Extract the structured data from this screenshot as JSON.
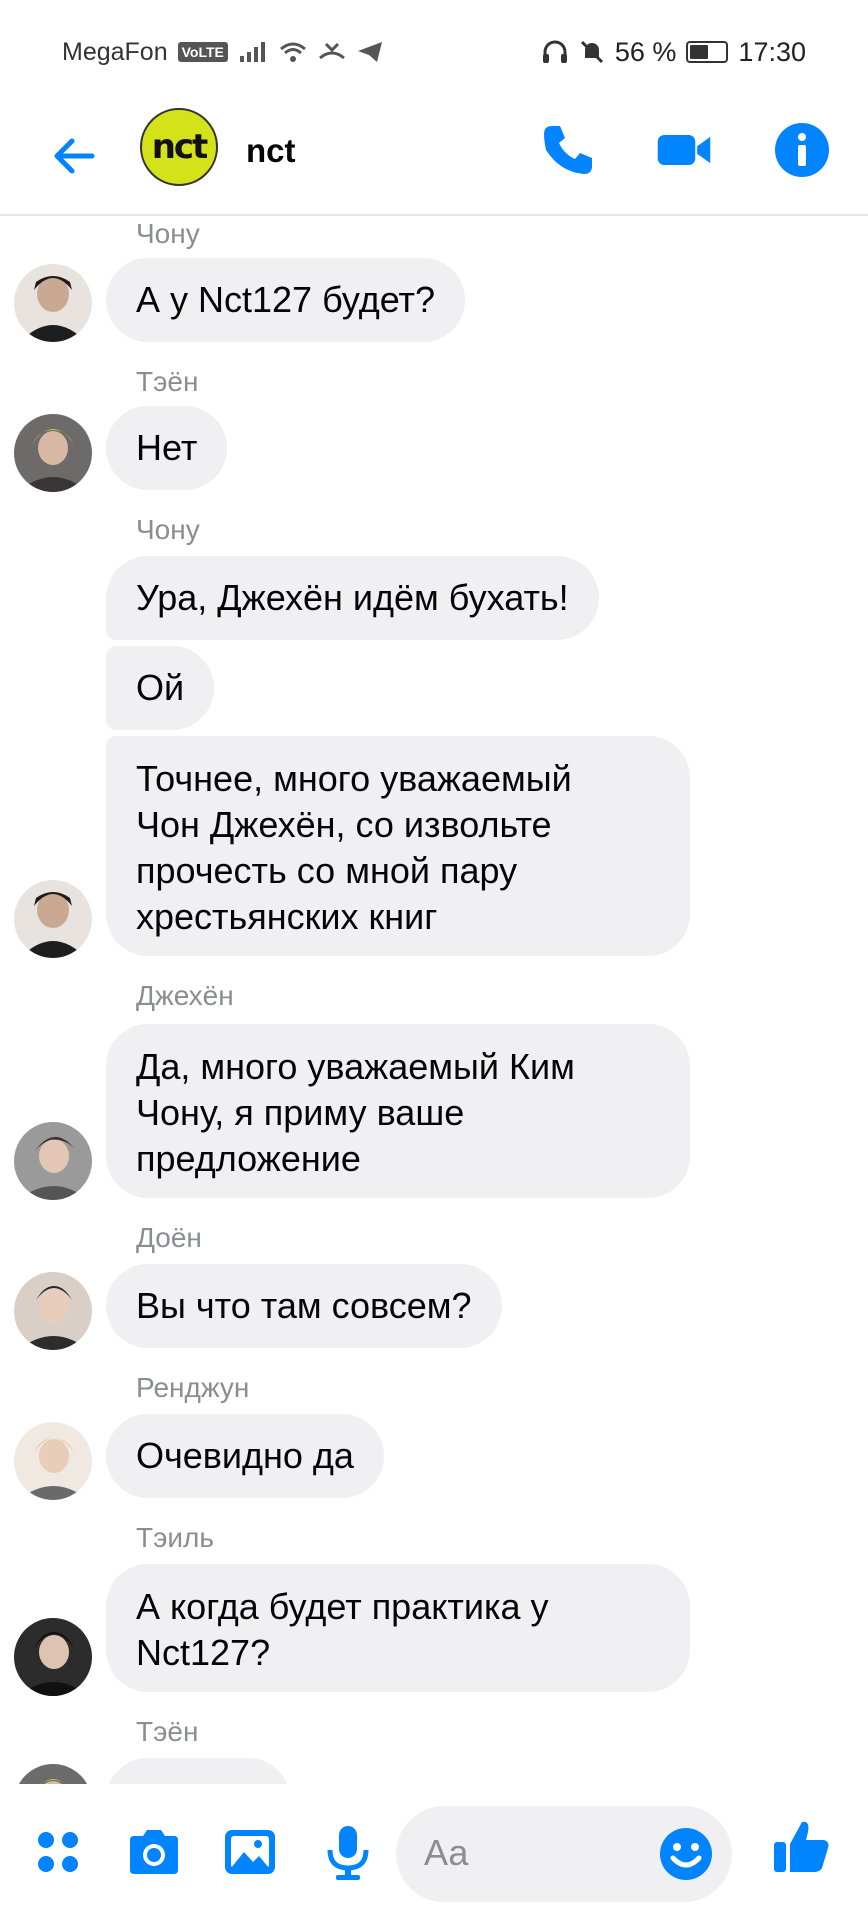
{
  "status": {
    "carrier": "MegaFon",
    "volte": "VoLTE",
    "battery": "56 %",
    "time": "17:30"
  },
  "header": {
    "avatar_text": "nct",
    "title": "nct"
  },
  "messages": [
    {
      "sender": "Чону",
      "texts": [
        "А у Nct127 будет?"
      ]
    },
    {
      "sender": "Тэён",
      "texts": [
        "Нет"
      ]
    },
    {
      "sender": "Чону",
      "texts": [
        "Ура, Джехён идём бухать!",
        "Ой",
        "Точнее, много уважаемый\nЧон Джехён, со извольте\nпрочесть со мной пару\nхрестьянских книг"
      ]
    },
    {
      "sender": "Джехён",
      "texts": [
        "Да, много уважаемый Ким\nЧону, я приму ваше\nпредложение"
      ]
    },
    {
      "sender": "Доён",
      "texts": [
        "Вы что там совсем?"
      ]
    },
    {
      "sender": "Ренджун",
      "texts": [
        "Очевидно да"
      ]
    },
    {
      "sender": "Тэиль",
      "texts": [
        "А когда будет практика у\nNct127?"
      ]
    },
    {
      "sender": "Тэён",
      "texts": [
        ""
      ]
    }
  ],
  "composer": {
    "placeholder": "Аа"
  },
  "colors": {
    "accent": "#0084ff",
    "bubble": "#f0f0f3",
    "sender_text": "#8a8d91"
  }
}
